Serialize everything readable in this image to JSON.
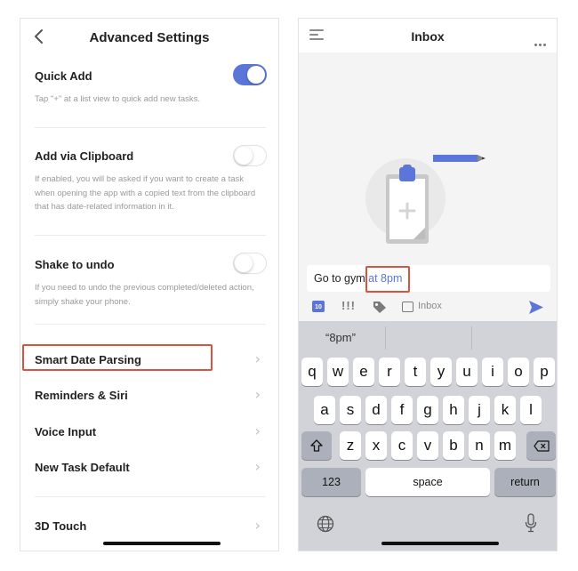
{
  "left": {
    "title": "Advanced Settings",
    "quick_add": {
      "title": "Quick Add",
      "desc": "Tap \"+\" at a list view to quick add new tasks.",
      "enabled": true
    },
    "clipboard": {
      "title": "Add via Clipboard",
      "desc": "If enabled, you will be asked if you want to create a task when opening the app with a copied text from the clipboard that has date-related information in it.",
      "enabled": false
    },
    "shake": {
      "title": "Shake to undo",
      "desc": "If you need to undo the previous completed/deleted action, simply shake your phone.",
      "enabled": false
    },
    "nav_items": [
      "Smart Date Parsing",
      "Reminders & Siri",
      "Voice Input",
      "New Task Default",
      "3D Touch"
    ]
  },
  "right": {
    "title": "Inbox",
    "input_text": "Go to gym ",
    "input_highlight": "at 8pm",
    "calendar_day": "10",
    "priority": "!!!",
    "list_label": "Inbox",
    "suggestion": "“8pm”",
    "keyboard": {
      "row1": [
        "q",
        "w",
        "e",
        "r",
        "t",
        "y",
        "u",
        "i",
        "o",
        "p"
      ],
      "row2": [
        "a",
        "s",
        "d",
        "f",
        "g",
        "h",
        "j",
        "k",
        "l"
      ],
      "row3": [
        "z",
        "x",
        "c",
        "v",
        "b",
        "n",
        "m"
      ],
      "numbers": "123",
      "space": "space",
      "return": "return"
    }
  },
  "colors": {
    "accent": "#5b76d8",
    "highlight": "#d9533f"
  }
}
